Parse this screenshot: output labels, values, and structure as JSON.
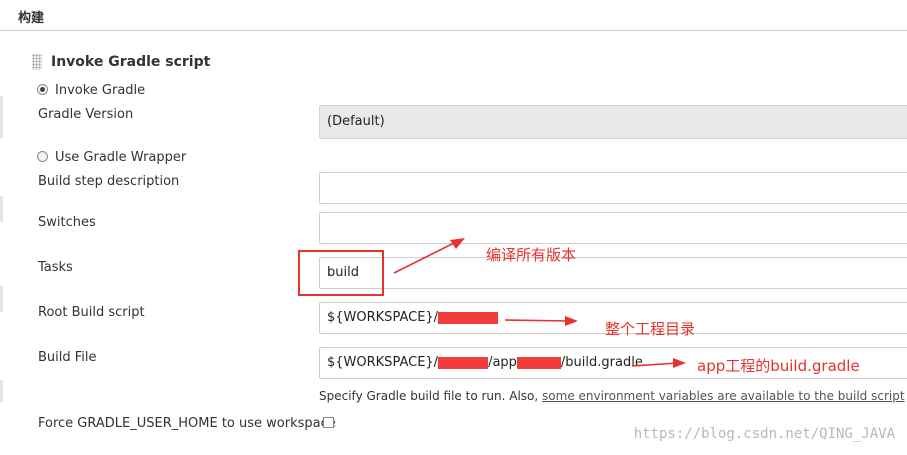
{
  "section": {
    "title": "构建"
  },
  "step": {
    "title": "Invoke Gradle script",
    "drag_icon": "drag-handle-icon"
  },
  "options": {
    "invoke_gradle": {
      "label": "Invoke Gradle",
      "selected": true
    },
    "use_wrapper": {
      "label": "Use Gradle Wrapper",
      "selected": false
    }
  },
  "fields": {
    "gradle_version": {
      "label": "Gradle Version",
      "value": "(Default)"
    },
    "build_step_description": {
      "label": "Build step description",
      "value": ""
    },
    "switches": {
      "label": "Switches",
      "value": ""
    },
    "tasks": {
      "label": "Tasks",
      "value": "build"
    },
    "root_build_script": {
      "label": "Root Build script",
      "value_prefix": "${WORKSPACE}/",
      "value_suffix": ""
    },
    "build_file": {
      "label": "Build File",
      "value_prefix": "${WORKSPACE}/",
      "value_mid": "/app",
      "value_suffix": "/build.gradle"
    }
  },
  "help": {
    "text": "Specify Gradle build file to run. Also, ",
    "link": "some environment variables are available to the build script"
  },
  "force_home": {
    "label": "Force GRADLE_USER_HOME to use workspace",
    "checked": false
  },
  "annotations": {
    "tasks_note": "编译所有版本",
    "root_note": "整个工程目录",
    "build_file_note": "app工程的build.gradle",
    "color": "#e8322d"
  },
  "watermark": "https://blog.csdn.net/QING_JAVA"
}
